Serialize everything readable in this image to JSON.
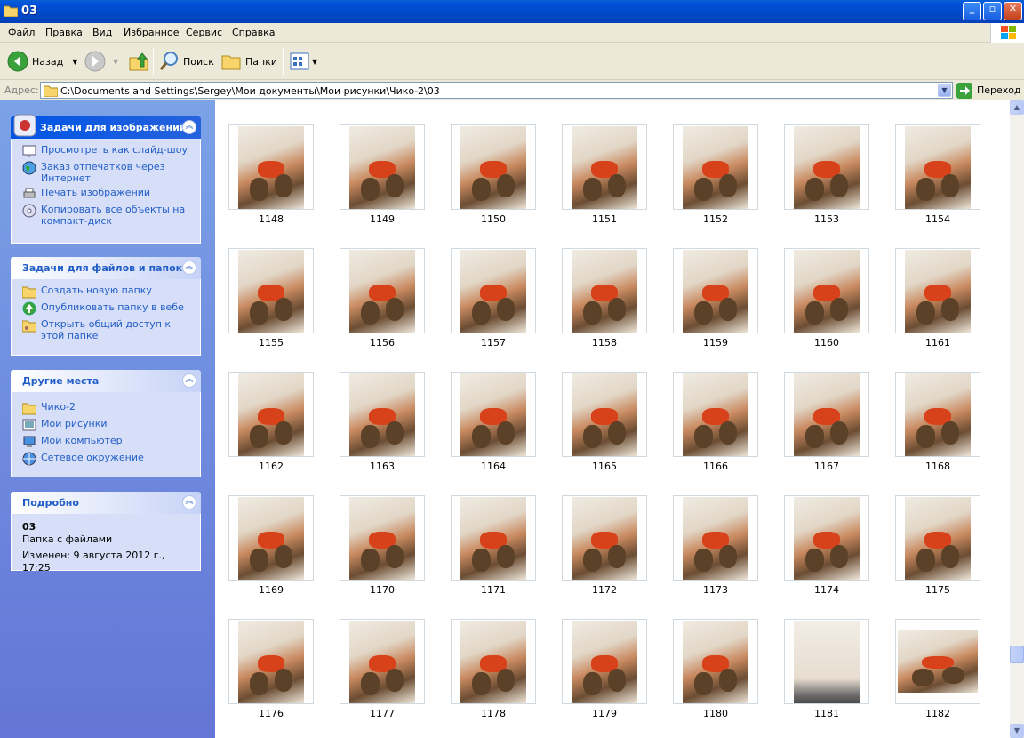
{
  "window": {
    "title": "03",
    "buttons": {
      "minimize": "_",
      "maximize": "▫",
      "close": "✕"
    }
  },
  "menu": [
    "Файл",
    "Правка",
    "Вид",
    "Избранное",
    "Сервис",
    "Справка"
  ],
  "toolbar": {
    "back_label": "Назад",
    "search_label": "Поиск",
    "folders_label": "Папки"
  },
  "address": {
    "label": "Адрес:",
    "path": "C:\\Documents and Settings\\Sergey\\Мои документы\\Мои рисунки\\Чико-2\\03",
    "go_label": "Переход"
  },
  "panels": {
    "image_tasks": {
      "title": "Задачи для изображений",
      "items": [
        "Просмотреть как слайд-шоу",
        "Заказ отпечатков через Интернет",
        "Печать изображений",
        "Копировать все объекты на компакт-диск"
      ]
    },
    "file_tasks": {
      "title": "Задачи для файлов и папок",
      "items": [
        "Создать новую папку",
        "Опубликовать папку в вебе",
        "Открыть общий доступ к этой папке"
      ]
    },
    "other_places": {
      "title": "Другие места",
      "items": [
        "Чико-2",
        "Мои рисунки",
        "Мой компьютер",
        "Сетевое окружение"
      ]
    },
    "details": {
      "title": "Подробно",
      "name": "03",
      "type": "Папка с файлами",
      "modified": "Изменен: 9 августа 2012 г., 17:25"
    }
  },
  "files": [
    "1148",
    "1149",
    "1150",
    "1151",
    "1152",
    "1153",
    "1154",
    "1155",
    "1156",
    "1157",
    "1158",
    "1159",
    "1160",
    "1161",
    "1162",
    "1163",
    "1164",
    "1165",
    "1166",
    "1167",
    "1168",
    "1169",
    "1170",
    "1171",
    "1172",
    "1173",
    "1174",
    "1175",
    "1176",
    "1177",
    "1178",
    "1179",
    "1180",
    "1181",
    "1182"
  ],
  "colors": {
    "titlebar": "#0050d8",
    "leftpane": "#6d8de0",
    "link": "#215dc6"
  }
}
